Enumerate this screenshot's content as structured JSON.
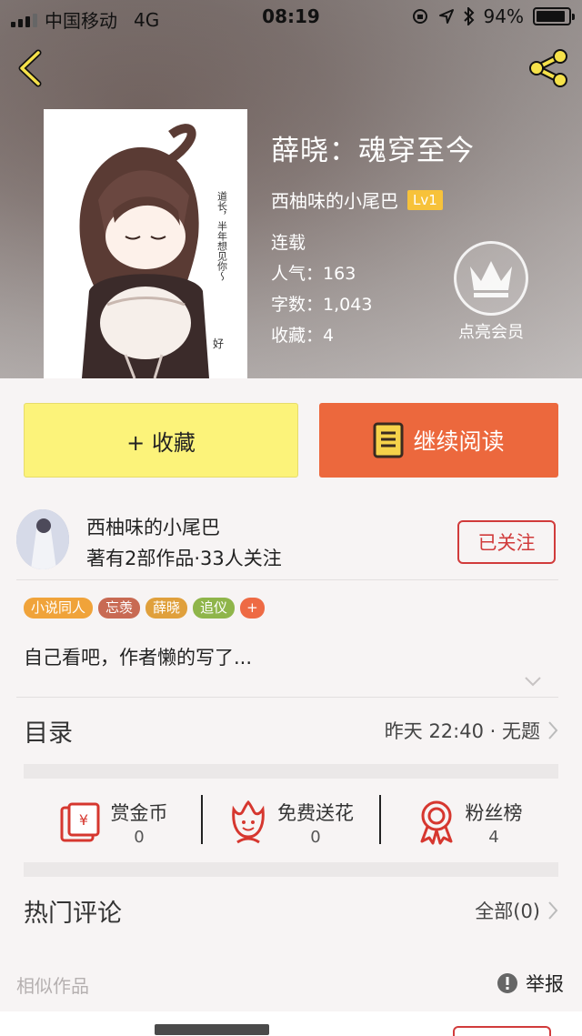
{
  "status_bar": {
    "carrier": "中国移动",
    "network": "4G",
    "time": "08:19",
    "battery": "94%"
  },
  "book": {
    "title": "薛晓：魂穿至今",
    "author": "西柚味的小尾巴",
    "level": "Lv1",
    "status": "连载",
    "popularity_label": "人气：",
    "popularity": "163",
    "words_label": "字数：",
    "words": "1,043",
    "favorites_label": "收藏：",
    "favorites": "4",
    "cover_text": "道长，半年想见你～"
  },
  "vip": {
    "label": "点亮会员"
  },
  "actions": {
    "favorite": "+ 收藏",
    "continue_reading": "继续阅读"
  },
  "author_card": {
    "name": "西柚味的小尾巴",
    "stats": "著有2部作品·33人关注",
    "follow": "已关注"
  },
  "tags": [
    {
      "label": "小说同人",
      "color": "#f0a33a"
    },
    {
      "label": "忘羡",
      "color": "#c86a53"
    },
    {
      "label": "薛晓",
      "color": "#e0a03c"
    },
    {
      "label": "追仪",
      "color": "#8fb54a"
    },
    {
      "label": "+",
      "color": "#ee6a44"
    }
  ],
  "summary": "自己看吧，作者懒的写了...",
  "catalog": {
    "title": "目录",
    "latest": "昨天 22:40 · 无题"
  },
  "rewards": [
    {
      "label": "赏金币",
      "value": "0",
      "icon": "red-envelope-icon"
    },
    {
      "label": "免费送花",
      "value": "0",
      "icon": "flower-icon"
    },
    {
      "label": "粉丝榜",
      "value": "4",
      "icon": "medal-icon"
    }
  ],
  "comments": {
    "title": "热门评论",
    "all": "全部(0)"
  },
  "similar": {
    "title": "相似作品",
    "report": "举报"
  },
  "colors": {
    "accent_orange": "#ec683d",
    "favorite_yellow": "#fcf37a",
    "follow_red": "#d13b3b",
    "level_badge": "#f7c23a"
  }
}
